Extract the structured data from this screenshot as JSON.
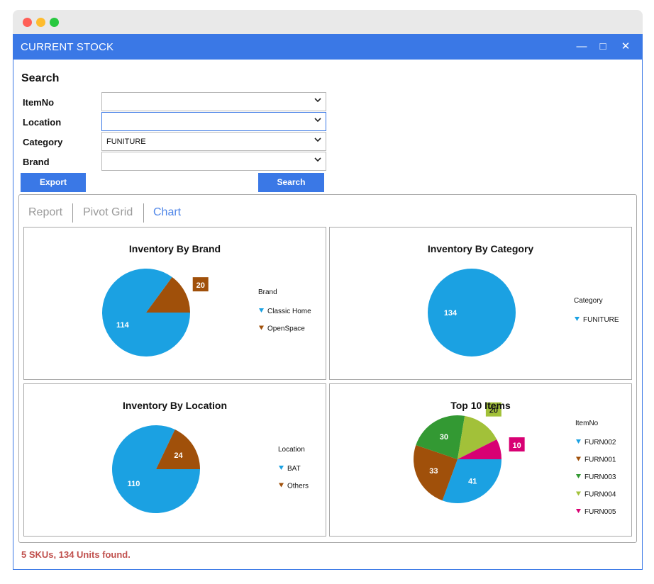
{
  "window": {
    "title": "CURRENT STOCK",
    "minimize_icon": "—",
    "maximize_icon": "□",
    "close_icon": "✕"
  },
  "search": {
    "heading": "Search",
    "fields": [
      {
        "label": "ItemNo",
        "value": ""
      },
      {
        "label": "Location",
        "value": ""
      },
      {
        "label": "Category",
        "value": "FUNITURE"
      },
      {
        "label": "Brand",
        "value": ""
      }
    ],
    "export_label": "Export",
    "search_label": "Search"
  },
  "tabs": [
    {
      "label": "Report",
      "active": false
    },
    {
      "label": "Pivot Grid",
      "active": false
    },
    {
      "label": "Chart",
      "active": true
    }
  ],
  "chart_data": [
    {
      "type": "pie",
      "title": "Inventory By Brand",
      "legend_title": "Brand",
      "legend_position": "right",
      "slices": [
        {
          "name": "Classic Home",
          "value": 114,
          "color": "#1ba1e2"
        },
        {
          "name": "OpenSpace",
          "value": 20,
          "color": "#a0500a"
        }
      ]
    },
    {
      "type": "pie",
      "title": "Inventory By Category",
      "legend_title": "Category",
      "legend_position": "right",
      "slices": [
        {
          "name": "FUNITURE",
          "value": 134,
          "color": "#1ba1e2"
        }
      ]
    },
    {
      "type": "pie",
      "title": "Inventory By Location",
      "legend_title": "Location",
      "legend_position": "right",
      "slices": [
        {
          "name": "BAT",
          "value": 110,
          "color": "#1ba1e2"
        },
        {
          "name": "Others",
          "value": 24,
          "color": "#a0500a"
        }
      ]
    },
    {
      "type": "pie",
      "title": "Top 10 Items",
      "legend_title": "ItemNo",
      "legend_position": "right",
      "slices": [
        {
          "name": "FURN002",
          "value": 41,
          "color": "#1ba1e2"
        },
        {
          "name": "FURN001",
          "value": 33,
          "color": "#a0500a"
        },
        {
          "name": "FURN003",
          "value": 30,
          "color": "#339933"
        },
        {
          "name": "FURN004",
          "value": 20,
          "color": "#a2c139"
        },
        {
          "name": "FURN005",
          "value": 10,
          "color": "#d80073"
        }
      ]
    }
  ],
  "status": {
    "text": "5 SKUs, 134 Units found.",
    "color": "#c0504d"
  }
}
